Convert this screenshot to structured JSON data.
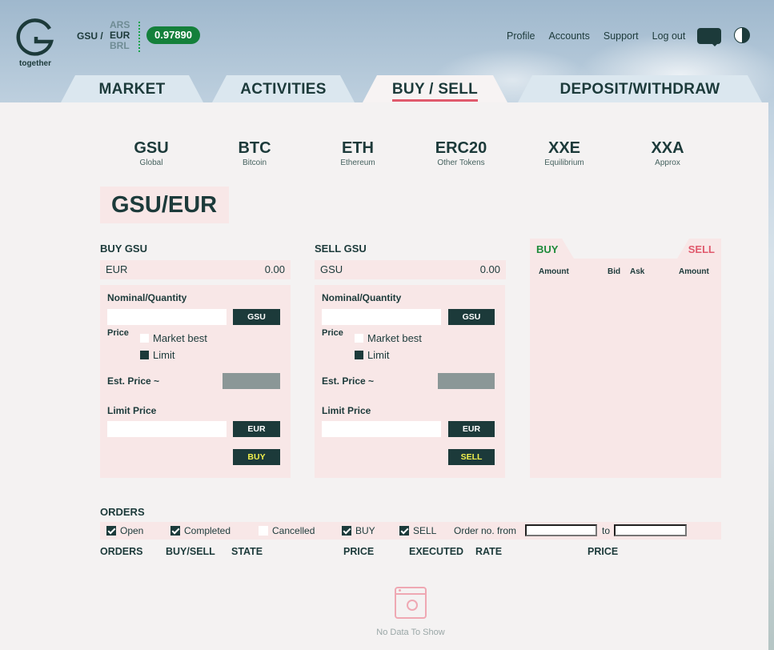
{
  "header": {
    "logo_text": "together",
    "base_currency": "GSU /",
    "currencies": [
      "ARS",
      "EUR",
      "BRL"
    ],
    "active_currency": "EUR",
    "rate": "0.97890",
    "nav": [
      "Profile",
      "Accounts",
      "Support",
      "Log out"
    ],
    "chat_icon": "chat-icon",
    "theme_icon": "theme-toggle-icon"
  },
  "tabs": [
    {
      "label": "MARKET"
    },
    {
      "label": "ACTIVITIES"
    },
    {
      "label": "BUY / SELL",
      "active": true
    },
    {
      "label": "DEPOSIT/WITHDRAW"
    }
  ],
  "coins": [
    {
      "symbol": "GSU",
      "name": "Global"
    },
    {
      "symbol": "BTC",
      "name": "Bitcoin"
    },
    {
      "symbol": "ETH",
      "name": "Ethereum"
    },
    {
      "symbol": "ERC20",
      "name": "Other Tokens"
    },
    {
      "symbol": "XXE",
      "name": "Equilibrium"
    },
    {
      "symbol": "XXA",
      "name": "Approx"
    }
  ],
  "pair_title": "GSU/EUR",
  "buy": {
    "title": "BUY GSU",
    "balance_currency": "EUR",
    "balance_value": "0.00",
    "nominal_label": "Nominal/Quantity",
    "nominal_unit": "GSU",
    "price_label": "Price",
    "option_market": "Market best",
    "option_limit": "Limit",
    "est_label": "Est. Price ~",
    "limit_label": "Limit Price",
    "limit_unit": "EUR",
    "action": "BUY"
  },
  "sell": {
    "title": "SELL GSU",
    "balance_currency": "GSU",
    "balance_value": "0.00",
    "nominal_label": "Nominal/Quantity",
    "nominal_unit": "GSU",
    "price_label": "Price",
    "option_market": "Market best",
    "option_limit": "Limit",
    "est_label": "Est. Price ~",
    "limit_label": "Limit Price",
    "limit_unit": "EUR",
    "action": "SELL"
  },
  "orderbook": {
    "buy_tab": "BUY",
    "sell_tab": "SELL",
    "columns": [
      "Amount",
      "Bid",
      "Ask",
      "Amount"
    ]
  },
  "orders": {
    "title": "ORDERS",
    "filters": [
      {
        "label": "Open",
        "checked": true
      },
      {
        "label": "Completed",
        "checked": true
      },
      {
        "label": "Cancelled",
        "checked": false
      },
      {
        "label": "BUY",
        "checked": true
      },
      {
        "label": "SELL",
        "checked": true
      }
    ],
    "order_from_label": "Order no. from",
    "order_to_label": "to",
    "columns": [
      "ORDERS",
      "BUY/SELL",
      "STATE",
      "PRICE",
      "EXECUTED",
      "RATE",
      "PRICE"
    ],
    "empty_text": "No Data To Show"
  },
  "colors": {
    "dark": "#1c3a3a",
    "accent_green": "#14803b",
    "accent_red": "#e05a6d",
    "panel_pink": "#f8e7e7"
  }
}
